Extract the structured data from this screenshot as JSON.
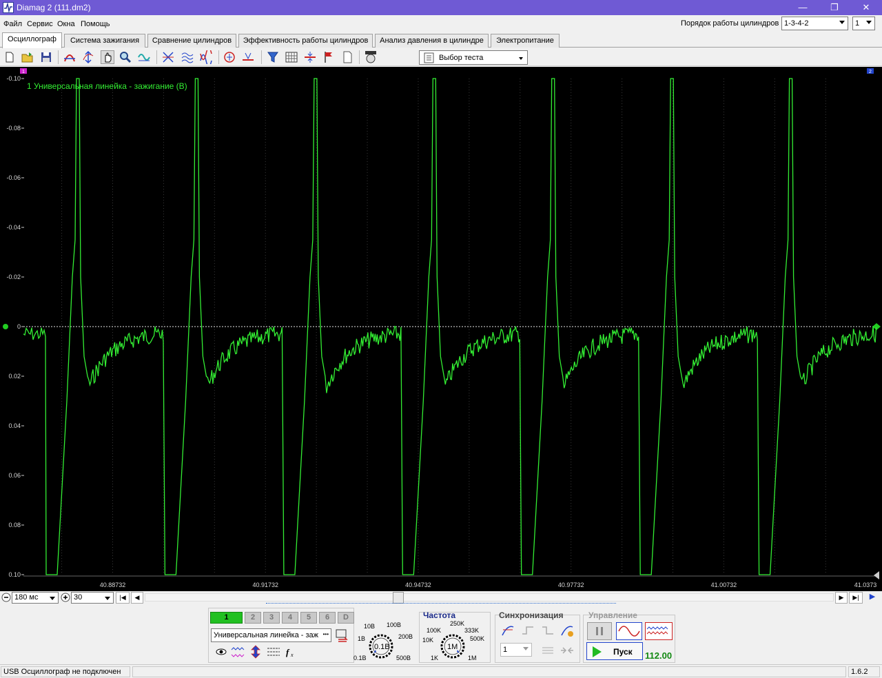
{
  "window": {
    "title": "Diamag 2 (111.dm2)"
  },
  "menu": [
    "Файл",
    "Сервис",
    "Окна",
    "Помощь"
  ],
  "firing_order": {
    "label": "Порядок работы цилиндров",
    "value": "1-3-4-2",
    "cylinder": "1"
  },
  "tabs": [
    "Осциллограф",
    "Система зажигания",
    "Сравнение цилиндров",
    "Эффективность работы цилиндров",
    "Анализ давления в цилиндре",
    "Электропитание"
  ],
  "active_tab": 0,
  "toolbar": {
    "test_select": "Выбор теста"
  },
  "scope": {
    "trace_label": "1 Универсальная линейка - зажигание (В)",
    "y_ticks": [
      "-0.10",
      "-0.08",
      "-0.06",
      "-0.04",
      "-0.02",
      "0",
      "0.02",
      "0.04",
      "0.06",
      "0.08",
      "0.10"
    ],
    "x_ticks": [
      "40.88732",
      "40.91732",
      "40.94732",
      "40.97732",
      "41.00732",
      "41.0373"
    ],
    "trace_color": "#33ee33",
    "marker_left": "1",
    "marker_right": "2",
    "period": 0.02333,
    "x_start": 40.8698,
    "x_end": 41.0373
  },
  "timebar": {
    "zoom": "180 мс",
    "offset": "30"
  },
  "channel_panel": {
    "channels": [
      "1",
      "2",
      "3",
      "4",
      "5",
      "6",
      "D"
    ],
    "source": "Универсальная линейка - заж",
    "more": "•••",
    "range_labels": [
      "10В",
      "100В",
      "1В",
      "200В",
      "0.1В",
      "500В"
    ],
    "range_value": "0.1В"
  },
  "frequency": {
    "title": "Частота",
    "labels": [
      "250K",
      "100K",
      "333K",
      "10K",
      "500K",
      "1K",
      "1M"
    ],
    "value": "1M"
  },
  "sync": {
    "title": "Синхронизация",
    "channel": "1"
  },
  "control": {
    "title": "Управление",
    "start": "Пуск",
    "rate": "112.00"
  },
  "status": {
    "text": "USB Осциллограф не подключен",
    "version": "1.6.2"
  }
}
